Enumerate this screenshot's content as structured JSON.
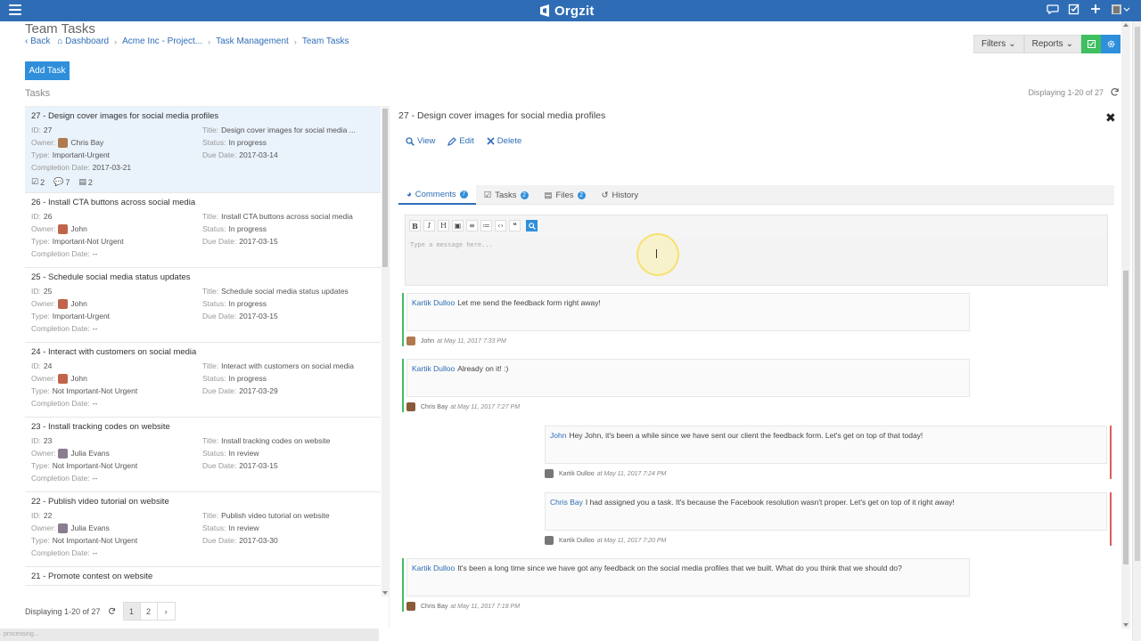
{
  "app": {
    "name": "Orgzit"
  },
  "colors": {
    "topbar": "#2e6db6",
    "accent": "#2f8fdb",
    "green": "#3fbf5f",
    "red": "#e05c5c"
  },
  "header": {
    "title": "Team Tasks",
    "breadcrumb": [
      "Back",
      "Dashboard",
      "Acme Inc - Project...",
      "Task Management",
      "Team Tasks"
    ],
    "filters_label": "Filters",
    "reports_label": "Reports"
  },
  "toolbar": {
    "add_task_label": "Add Task"
  },
  "tasks": {
    "label": "Tasks",
    "displaying": "Displaying 1-20 of 27",
    "items": [
      {
        "heading": "27 - Design cover images for social media profiles",
        "id": "27",
        "owner": "Chris Bay",
        "type": "Important-Urgent",
        "completion": "2017-03-21",
        "title": "Design cover images for social media ...",
        "status": "In progress",
        "due": "2017-03-14",
        "checks": "2",
        "comments": "7",
        "files": "2"
      },
      {
        "heading": "26 - Install CTA buttons across social media",
        "id": "26",
        "owner": "John",
        "type": "Important-Not Urgent",
        "completion": "--",
        "title": "Install CTA buttons across social media",
        "status": "In progress",
        "due": "2017-03-15"
      },
      {
        "heading": "25 - Schedule social media status updates",
        "id": "25",
        "owner": "John",
        "type": "Important-Urgent",
        "completion": "--",
        "title": "Schedule social media status updates",
        "status": "In progress",
        "due": "2017-03-15"
      },
      {
        "heading": "24 - Interact with customers on social media",
        "id": "24",
        "owner": "John",
        "type": "Not Important-Not Urgent",
        "completion": "--",
        "title": "Interact with customers on social media",
        "status": "In progress",
        "due": "2017-03-29"
      },
      {
        "heading": "23 - Install tracking codes on website",
        "id": "23",
        "owner": "Julia Evans",
        "type": "Not Important-Not Urgent",
        "completion": "--",
        "title": "Install tracking codes on website",
        "status": "In review",
        "due": "2017-03-15"
      },
      {
        "heading": "22 - Publish video tutorial on website",
        "id": "22",
        "owner": "Julia Evans",
        "type": "Not Important-Not Urgent",
        "completion": "--",
        "title": "Publish video tutorial on website",
        "status": "In review",
        "due": "2017-03-30"
      },
      {
        "heading": "21 - Promote contest on website"
      }
    ],
    "field_labels": {
      "id": "ID:",
      "owner": "Owner:",
      "type": "Type:",
      "completion": "Completion Date:",
      "title": "Title:",
      "status": "Status:",
      "due": "Due Date:"
    }
  },
  "pager": {
    "displaying": "Displaying 1-20 of 27",
    "pages": [
      "1",
      "2",
      "›"
    ]
  },
  "footer_status": "processing...",
  "detail": {
    "title": "27 - Design cover images for social media profiles",
    "actions": {
      "view": "View",
      "edit": "Edit",
      "delete": "Delete"
    },
    "tabs": [
      {
        "label": "Comments",
        "badge": "7"
      },
      {
        "label": "Tasks",
        "badge": "2"
      },
      {
        "label": "Files",
        "badge": "2"
      },
      {
        "label": "History",
        "badge": ""
      }
    ],
    "editor": {
      "placeholder": "Type a message here...",
      "tools": [
        "B",
        "I",
        "H",
        "▣",
        "≡",
        "≔",
        "‹›",
        "❝"
      ]
    },
    "comments": [
      {
        "side": "left",
        "to": "Kartik Dulloo",
        "text": "Let me send the feedback form right away!",
        "author": "John",
        "when": "at May 11, 2017 7:33 PM"
      },
      {
        "side": "left",
        "to": "Kartik Dulloo",
        "text": "Already on it! :)",
        "author": "Chris Bay",
        "when": "at May 11, 2017 7:27 PM"
      },
      {
        "side": "right",
        "to": "John",
        "text": "Hey John, it's been a while since we have sent our client the feedback form. Let's get on top of that today!",
        "author": "Kartik Dulloo",
        "when": "at May 11, 2017 7:24 PM"
      },
      {
        "side": "right",
        "to": "Chris Bay",
        "text": "I had assigned you a task. It's because the Facebook resolution wasn't proper. Let's get on top of it right away!",
        "author": "Kartik Dulloo",
        "when": "at May 11, 2017 7:20 PM"
      },
      {
        "side": "left",
        "to": "Kartik Dulloo",
        "text": "It's been a long time since we have got any feedback on the social media profiles that we built. What do you think that we should do?",
        "author": "Chris Bay",
        "when": "at May 11, 2017 7:18 PM"
      }
    ]
  }
}
